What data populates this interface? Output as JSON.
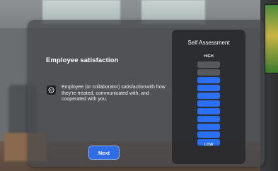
{
  "panel": {
    "title": "Employee satisfaction",
    "description": "Employee (or collaborator) satisfactionwith how they're treated, communicated with, and cooperated with  you.",
    "description_icon": "smiley-face-icon",
    "next_label": "Next"
  },
  "assessment": {
    "title": "Self Assessment",
    "high_label": "HIGH",
    "low_label": "LOW",
    "total_levels": 11,
    "selected_level": 9,
    "colors": {
      "selected": "#2b6ff2",
      "unselected": "#58595d"
    }
  },
  "colors": {
    "accent": "#2f6de6",
    "panel": "#46484c"
  }
}
